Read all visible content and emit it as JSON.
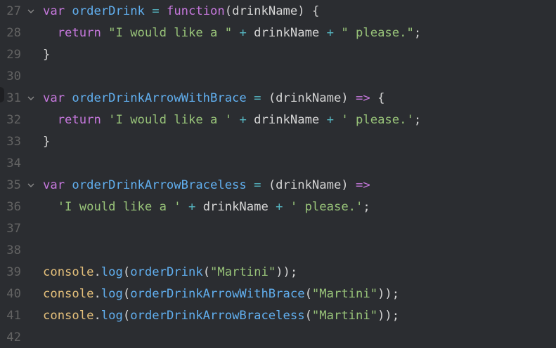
{
  "theme": {
    "background": "#2b2d31",
    "line_number": "#636363",
    "keyword": "#c678dd",
    "function": "#61afef",
    "string": "#98c379",
    "operator": "#56b6c2",
    "identifier": "#d4d4d4",
    "object": "#e5c07b"
  },
  "lines": [
    {
      "num": "27",
      "fold": true,
      "tokens": [
        {
          "t": "var",
          "c": "kw"
        },
        {
          "t": " ",
          "c": "id"
        },
        {
          "t": "orderDrink",
          "c": "fn"
        },
        {
          "t": " ",
          "c": "id"
        },
        {
          "t": "=",
          "c": "op"
        },
        {
          "t": " ",
          "c": "id"
        },
        {
          "t": "function",
          "c": "kw"
        },
        {
          "t": "(drinkName) {",
          "c": "id"
        }
      ]
    },
    {
      "num": "28",
      "fold": false,
      "tokens": [
        {
          "t": "  ",
          "c": "id"
        },
        {
          "t": "return",
          "c": "kw"
        },
        {
          "t": " ",
          "c": "id"
        },
        {
          "t": "\"I would like a \"",
          "c": "str"
        },
        {
          "t": " ",
          "c": "id"
        },
        {
          "t": "+",
          "c": "op"
        },
        {
          "t": " drinkName ",
          "c": "id"
        },
        {
          "t": "+",
          "c": "op"
        },
        {
          "t": " ",
          "c": "id"
        },
        {
          "t": "\" please.\"",
          "c": "str"
        },
        {
          "t": ";",
          "c": "id"
        }
      ]
    },
    {
      "num": "29",
      "fold": false,
      "tokens": [
        {
          "t": "}",
          "c": "id"
        }
      ]
    },
    {
      "num": "30",
      "fold": false,
      "tokens": []
    },
    {
      "num": "31",
      "fold": true,
      "tokens": [
        {
          "t": "var",
          "c": "kw"
        },
        {
          "t": " ",
          "c": "id"
        },
        {
          "t": "orderDrinkArrowWithBrace",
          "c": "fn"
        },
        {
          "t": " ",
          "c": "id"
        },
        {
          "t": "=",
          "c": "op"
        },
        {
          "t": " (drinkName) ",
          "c": "id"
        },
        {
          "t": "=>",
          "c": "kw"
        },
        {
          "t": " {",
          "c": "id"
        }
      ]
    },
    {
      "num": "32",
      "fold": false,
      "tokens": [
        {
          "t": "  ",
          "c": "id"
        },
        {
          "t": "return",
          "c": "kw"
        },
        {
          "t": " ",
          "c": "id"
        },
        {
          "t": "'I would like a '",
          "c": "str"
        },
        {
          "t": " ",
          "c": "id"
        },
        {
          "t": "+",
          "c": "op"
        },
        {
          "t": " drinkName ",
          "c": "id"
        },
        {
          "t": "+",
          "c": "op"
        },
        {
          "t": " ",
          "c": "id"
        },
        {
          "t": "' please.'",
          "c": "str"
        },
        {
          "t": ";",
          "c": "id"
        }
      ]
    },
    {
      "num": "33",
      "fold": false,
      "tokens": [
        {
          "t": "}",
          "c": "id"
        }
      ]
    },
    {
      "num": "34",
      "fold": false,
      "tokens": []
    },
    {
      "num": "35",
      "fold": true,
      "tokens": [
        {
          "t": "var",
          "c": "kw"
        },
        {
          "t": " ",
          "c": "id"
        },
        {
          "t": "orderDrinkArrowBraceless",
          "c": "fn"
        },
        {
          "t": " ",
          "c": "id"
        },
        {
          "t": "=",
          "c": "op"
        },
        {
          "t": " (drinkName) ",
          "c": "id"
        },
        {
          "t": "=>",
          "c": "kw"
        }
      ]
    },
    {
      "num": "36",
      "fold": false,
      "tokens": [
        {
          "t": "  ",
          "c": "id"
        },
        {
          "t": "'I would like a '",
          "c": "str"
        },
        {
          "t": " ",
          "c": "id"
        },
        {
          "t": "+",
          "c": "op"
        },
        {
          "t": " drinkName ",
          "c": "id"
        },
        {
          "t": "+",
          "c": "op"
        },
        {
          "t": " ",
          "c": "id"
        },
        {
          "t": "' please.'",
          "c": "str"
        },
        {
          "t": ";",
          "c": "id"
        }
      ]
    },
    {
      "num": "37",
      "fold": false,
      "tokens": []
    },
    {
      "num": "38",
      "fold": false,
      "tokens": []
    },
    {
      "num": "39",
      "fold": false,
      "tokens": [
        {
          "t": "console",
          "c": "obj"
        },
        {
          "t": ".",
          "c": "id"
        },
        {
          "t": "log",
          "c": "fn"
        },
        {
          "t": "(",
          "c": "id"
        },
        {
          "t": "orderDrink",
          "c": "fn"
        },
        {
          "t": "(",
          "c": "id"
        },
        {
          "t": "\"Martini\"",
          "c": "str"
        },
        {
          "t": "));",
          "c": "id"
        }
      ]
    },
    {
      "num": "40",
      "fold": false,
      "tokens": [
        {
          "t": "console",
          "c": "obj"
        },
        {
          "t": ".",
          "c": "id"
        },
        {
          "t": "log",
          "c": "fn"
        },
        {
          "t": "(",
          "c": "id"
        },
        {
          "t": "orderDrinkArrowWithBrace",
          "c": "fn"
        },
        {
          "t": "(",
          "c": "id"
        },
        {
          "t": "\"Martini\"",
          "c": "str"
        },
        {
          "t": "));",
          "c": "id"
        }
      ]
    },
    {
      "num": "41",
      "fold": false,
      "tokens": [
        {
          "t": "console",
          "c": "obj"
        },
        {
          "t": ".",
          "c": "id"
        },
        {
          "t": "log",
          "c": "fn"
        },
        {
          "t": "(",
          "c": "id"
        },
        {
          "t": "orderDrinkArrowBraceless",
          "c": "fn"
        },
        {
          "t": "(",
          "c": "id"
        },
        {
          "t": "\"Martini\"",
          "c": "str"
        },
        {
          "t": "));",
          "c": "id"
        }
      ]
    },
    {
      "num": "42",
      "fold": false,
      "tokens": []
    }
  ],
  "fold_icon": "chevron-down-icon"
}
